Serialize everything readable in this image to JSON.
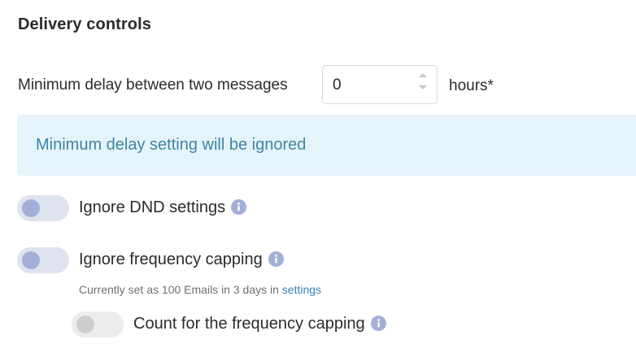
{
  "section": {
    "title": "Delivery controls"
  },
  "delay": {
    "label": "Minimum delay between two messages",
    "value": "0",
    "unit_label": "hours*"
  },
  "banner": {
    "text": "Minimum delay setting will be ignored"
  },
  "toggles": [
    {
      "label": "Ignore DND settings",
      "on": false,
      "icon": "info-icon"
    },
    {
      "label": "Ignore frequency capping",
      "on": false,
      "icon": "info-icon"
    },
    {
      "label": "Count for the frequency capping",
      "on": false,
      "disabled": true,
      "icon": "info-icon"
    }
  ],
  "frequency_note": {
    "prefix": "Currently set as 100 Emails in 3 days in",
    "link": "settings"
  },
  "colors": {
    "banner_bg": "#e5f3fb",
    "banner_text": "#3e86a3",
    "toggle_track": "#dfe3ef",
    "toggle_knob": "#a2b0d8",
    "info_icon": "#a2b0d8",
    "link": "#3b82b8"
  }
}
